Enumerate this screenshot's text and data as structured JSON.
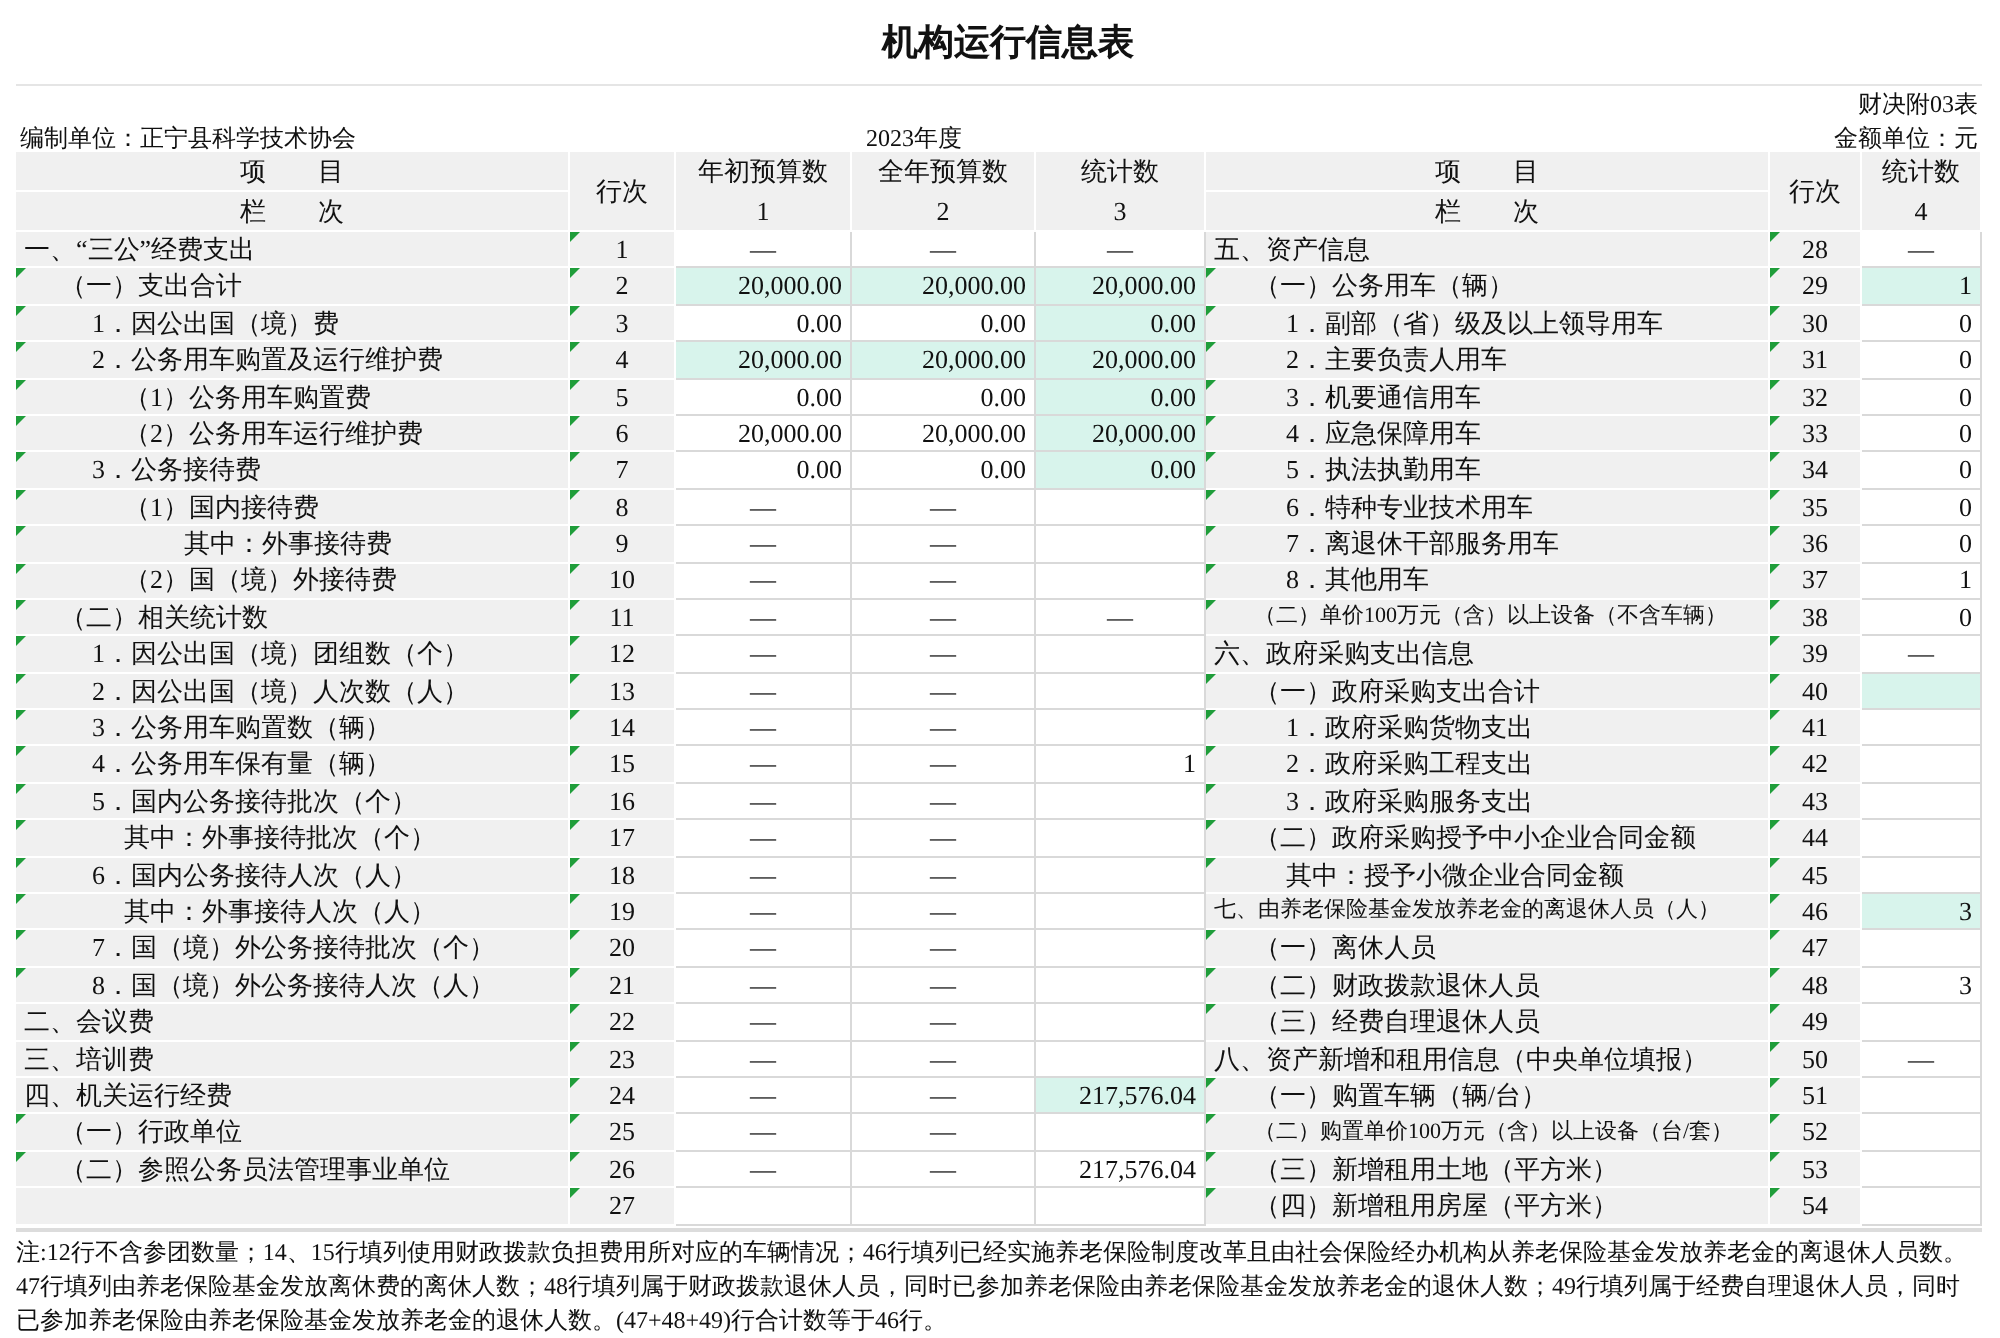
{
  "title": "机构运行信息表",
  "form_code": "财决附03表",
  "unit": "编制单位：正宁县科学技术协会",
  "period": "2023年度",
  "currency_unit": "金额单位：元",
  "left_header": {
    "item": "项　　目",
    "index_label": "栏　　次",
    "line": "行次",
    "columns": [
      {
        "name": "年初预算数",
        "number": "1"
      },
      {
        "name": "全年预算数",
        "number": "2"
      },
      {
        "name": "统计数",
        "number": "3"
      }
    ]
  },
  "right_header": {
    "item": "项　　目",
    "index_label": "栏　　次",
    "line": "行次",
    "columns": [
      {
        "name": "统计数",
        "number": "4"
      }
    ]
  },
  "left_rows": [
    {
      "item": "一、“三公”经费支出",
      "line": "1",
      "values": [
        {
          "text": "—",
          "highlighted": false
        },
        {
          "text": "—",
          "highlighted": false
        },
        {
          "text": "—",
          "highlighted": false
        }
      ],
      "children": [
        {
          "item": "（一）支出合计",
          "line": "2",
          "values": [
            {
              "text": "20,000.00",
              "highlighted": true
            },
            {
              "text": "20,000.00",
              "highlighted": true
            },
            {
              "text": "20,000.00",
              "highlighted": true
            }
          ],
          "children": [
            {
              "item": "1．因公出国（境）费",
              "line": "3",
              "values": [
                {
                  "text": "0.00",
                  "highlighted": false
                },
                {
                  "text": "0.00",
                  "highlighted": false
                },
                {
                  "text": "0.00",
                  "highlighted": true
                }
              ]
            },
            {
              "item": "2．公务用车购置及运行维护费",
              "line": "4",
              "values": [
                {
                  "text": "20,000.00",
                  "highlighted": true
                },
                {
                  "text": "20,000.00",
                  "highlighted": true
                },
                {
                  "text": "20,000.00",
                  "highlighted": true
                }
              ],
              "children": [
                {
                  "item": "（1）公务用车购置费",
                  "line": "5",
                  "values": [
                    {
                      "text": "0.00",
                      "highlighted": false
                    },
                    {
                      "text": "0.00",
                      "highlighted": false
                    },
                    {
                      "text": "0.00",
                      "highlighted": true
                    }
                  ]
                },
                {
                  "item": "（2）公务用车运行维护费",
                  "line": "6",
                  "values": [
                    {
                      "text": "20,000.00",
                      "highlighted": false
                    },
                    {
                      "text": "20,000.00",
                      "highlighted": false
                    },
                    {
                      "text": "20,000.00",
                      "highlighted": true
                    }
                  ]
                }
              ]
            },
            {
              "item": "3．公务接待费",
              "line": "7",
              "values": [
                {
                  "text": "0.00",
                  "highlighted": false
                },
                {
                  "text": "0.00",
                  "highlighted": false
                },
                {
                  "text": "0.00",
                  "highlighted": true
                }
              ],
              "children": [
                {
                  "item": "（1）国内接待费",
                  "line": "8",
                  "values": [
                    {
                      "text": "—",
                      "highlighted": false
                    },
                    {
                      "text": "—",
                      "highlighted": false
                    },
                    {
                      "highlighted": false
                    }
                  ],
                  "children": [
                    {
                      "item": "其中：外事接待费",
                      "line": "9",
                      "values": [
                        {
                          "text": "—",
                          "highlighted": false
                        },
                        {
                          "text": "—",
                          "highlighted": false
                        },
                        {
                          "highlighted": false
                        }
                      ]
                    }
                  ]
                },
                {
                  "item": "（2）国（境）外接待费",
                  "line": "10",
                  "values": [
                    {
                      "text": "—",
                      "highlighted": false
                    },
                    {
                      "text": "—",
                      "highlighted": false
                    },
                    {
                      "highlighted": false
                    }
                  ]
                }
              ]
            }
          ]
        },
        {
          "item": "（二）相关统计数",
          "line": "11",
          "values": [
            {
              "text": "—",
              "highlighted": false
            },
            {
              "text": "—",
              "highlighted": false
            },
            {
              "text": "—",
              "highlighted": false
            }
          ],
          "children": [
            {
              "item": "1．因公出国（境）团组数（个）",
              "line": "12",
              "values": [
                {
                  "text": "—",
                  "highlighted": false
                },
                {
                  "text": "—",
                  "highlighted": false
                },
                {
                  "highlighted": false
                }
              ]
            },
            {
              "item": "2．因公出国（境）人次数（人）",
              "line": "13",
              "values": [
                {
                  "text": "—",
                  "highlighted": false
                },
                {
                  "text": "—",
                  "highlighted": false
                },
                {
                  "highlighted": false
                }
              ]
            },
            {
              "item": "3．公务用车购置数（辆）",
              "line": "14",
              "values": [
                {
                  "text": "—",
                  "highlighted": false
                },
                {
                  "text": "—",
                  "highlighted": false
                },
                {
                  "highlighted": false
                }
              ]
            },
            {
              "item": "4．公务用车保有量（辆）",
              "line": "15",
              "values": [
                {
                  "text": "—",
                  "highlighted": false
                },
                {
                  "text": "—",
                  "highlighted": false
                },
                {
                  "text": "1",
                  "highlighted": false
                }
              ]
            },
            {
              "item": "5．国内公务接待批次（个）",
              "line": "16",
              "values": [
                {
                  "text": "—",
                  "highlighted": false
                },
                {
                  "text": "—",
                  "highlighted": false
                },
                {
                  "highlighted": false
                }
              ],
              "children": [
                {
                  "item": "其中：外事接待批次（个）",
                  "line": "17",
                  "values": [
                    {
                      "text": "—",
                      "highlighted": false
                    },
                    {
                      "text": "—",
                      "highlighted": false
                    },
                    {
                      "highlighted": false
                    }
                  ]
                }
              ]
            },
            {
              "item": "6．国内公务接待人次（人）",
              "line": "18",
              "values": [
                {
                  "text": "—",
                  "highlighted": false
                },
                {
                  "text": "—",
                  "highlighted": false
                },
                {
                  "highlighted": false
                }
              ],
              "children": [
                {
                  "item": "其中：外事接待人次（人）",
                  "line": "19",
                  "values": [
                    {
                      "text": "—",
                      "highlighted": false
                    },
                    {
                      "text": "—",
                      "highlighted": false
                    },
                    {
                      "highlighted": false
                    }
                  ]
                }
              ]
            },
            {
              "item": "7．国（境）外公务接待批次（个）",
              "line": "20",
              "values": [
                {
                  "text": "—",
                  "highlighted": false
                },
                {
                  "text": "—",
                  "highlighted": false
                },
                {
                  "highlighted": false
                }
              ]
            },
            {
              "item": "8．国（境）外公务接待人次（人）",
              "line": "21",
              "values": [
                {
                  "text": "—",
                  "highlighted": false
                },
                {
                  "text": "—",
                  "highlighted": false
                },
                {
                  "highlighted": false
                }
              ]
            }
          ]
        }
      ]
    },
    {
      "item": "二、会议费",
      "line": "22",
      "values": [
        {
          "text": "—",
          "highlighted": false
        },
        {
          "text": "—",
          "highlighted": false
        },
        {
          "highlighted": false
        }
      ]
    },
    {
      "item": "三、培训费",
      "line": "23",
      "values": [
        {
          "text": "—",
          "highlighted": false
        },
        {
          "text": "—",
          "highlighted": false
        },
        {
          "highlighted": false
        }
      ]
    },
    {
      "item": "四、机关运行经费",
      "line": "24",
      "values": [
        {
          "text": "—",
          "highlighted": false
        },
        {
          "text": "—",
          "highlighted": false
        },
        {
          "text": "217,576.04",
          "highlighted": true
        }
      ],
      "children": [
        {
          "item": "（一）行政单位",
          "line": "25",
          "values": [
            {
              "text": "—",
              "highlighted": false
            },
            {
              "text": "—",
              "highlighted": false
            },
            {
              "highlighted": false
            }
          ]
        },
        {
          "item": "（二）参照公务员法管理事业单位",
          "line": "26",
          "values": [
            {
              "text": "—",
              "highlighted": false
            },
            {
              "text": "—",
              "highlighted": false
            },
            {
              "text": "217,576.04",
              "highlighted": false
            }
          ]
        }
      ]
    },
    {
      "line": "27",
      "values": [
        {
          "highlighted": false
        },
        {
          "highlighted": false
        },
        {
          "highlighted": false
        }
      ]
    }
  ],
  "right_rows": [
    {
      "item": "五、资产信息",
      "line": "28",
      "values": [
        {
          "text": "—",
          "highlighted": false
        }
      ],
      "children": [
        {
          "item": "（一）公务用车（辆）",
          "line": "29",
          "values": [
            {
              "text": "1",
              "highlighted": true
            }
          ],
          "children": [
            {
              "item": "1．副部（省）级及以上领导用车",
              "line": "30",
              "values": [
                {
                  "text": "0",
                  "highlighted": false
                }
              ]
            },
            {
              "item": "2．主要负责人用车",
              "line": "31",
              "values": [
                {
                  "text": "0",
                  "highlighted": false
                }
              ]
            },
            {
              "item": "3．机要通信用车",
              "line": "32",
              "values": [
                {
                  "text": "0",
                  "highlighted": false
                }
              ]
            },
            {
              "item": "4．应急保障用车",
              "line": "33",
              "values": [
                {
                  "text": "0",
                  "highlighted": false
                }
              ]
            },
            {
              "item": "5．执法执勤用车",
              "line": "34",
              "values": [
                {
                  "text": "0",
                  "highlighted": false
                }
              ]
            },
            {
              "item": "6．特种专业技术用车",
              "line": "35",
              "values": [
                {
                  "text": "0",
                  "highlighted": false
                }
              ]
            },
            {
              "item": "7．离退休干部服务用车",
              "line": "36",
              "values": [
                {
                  "text": "0",
                  "highlighted": false
                }
              ]
            },
            {
              "item": "8．其他用车",
              "line": "37",
              "values": [
                {
                  "text": "1",
                  "highlighted": false
                }
              ]
            }
          ]
        },
        {
          "item": "（二）单价100万元（含）以上设备（不含车辆）",
          "line": "38",
          "compact": true,
          "values": [
            {
              "text": "0",
              "highlighted": false
            }
          ]
        }
      ]
    },
    {
      "item": "六、政府采购支出信息",
      "line": "39",
      "values": [
        {
          "text": "—",
          "highlighted": false
        }
      ],
      "children": [
        {
          "item": "（一）政府采购支出合计",
          "line": "40",
          "values": [
            {
              "highlighted": true
            }
          ],
          "children": [
            {
              "item": "1．政府采购货物支出",
              "line": "41",
              "values": [
                {
                  "highlighted": false
                }
              ]
            },
            {
              "item": "2．政府采购工程支出",
              "line": "42",
              "values": [
                {
                  "highlighted": false
                }
              ]
            },
            {
              "item": "3．政府采购服务支出",
              "line": "43",
              "values": [
                {
                  "highlighted": false
                }
              ]
            }
          ]
        },
        {
          "item": "（二）政府采购授予中小企业合同金额",
          "line": "44",
          "values": [
            {
              "highlighted": false
            }
          ],
          "children": [
            {
              "item": "其中：授予小微企业合同金额",
              "line": "45",
              "values": [
                {
                  "highlighted": false
                }
              ]
            }
          ]
        }
      ]
    },
    {
      "item": "七、由养老保险基金发放养老金的离退休人员（人）",
      "line": "46",
      "compact": true,
      "values": [
        {
          "text": "3",
          "highlighted": true
        }
      ],
      "children": [
        {
          "item": "（一）离休人员",
          "line": "47",
          "values": [
            {
              "highlighted": false
            }
          ]
        },
        {
          "item": "（二）财政拨款退休人员",
          "line": "48",
          "values": [
            {
              "text": "3",
              "highlighted": false
            }
          ]
        },
        {
          "item": "（三）经费自理退休人员",
          "line": "49",
          "values": [
            {
              "highlighted": false
            }
          ]
        }
      ]
    },
    {
      "item": "八、资产新增和租用信息（中央单位填报）",
      "line": "50",
      "values": [
        {
          "text": "—",
          "highlighted": false
        }
      ],
      "children": [
        {
          "item": "（一）购置车辆（辆/台）",
          "line": "51",
          "values": [
            {
              "highlighted": false
            }
          ]
        },
        {
          "item": "（二）购置单价100万元（含）以上设备（台/套）",
          "line": "52",
          "compact": true,
          "values": [
            {
              "highlighted": false
            }
          ]
        },
        {
          "item": "（三）新增租用土地（平方米）",
          "line": "53",
          "values": [
            {
              "highlighted": false
            }
          ]
        },
        {
          "item": "（四）新增租用房屋（平方米）",
          "line": "54",
          "values": [
            {
              "highlighted": false
            }
          ]
        }
      ]
    }
  ],
  "note": "注:12行不含参团数量；14、15行填列使用财政拨款负担费用所对应的车辆情况；46行填列已经实施养老保险制度改革且由社会保险经办机构从养老保险基金发放养老金的离退休人员数。47行填列由养老保险基金发放离休费的离休人数；48行填列属于财政拨款退休人员，同时已参加养老保险由养老保险基金发放养老金的退休人数；49行填列属于经费自理退休人员，同时已参加养老保险由养老保险基金发放养老金的退休人数。(47+48+49)行合计数等于46行。"
}
